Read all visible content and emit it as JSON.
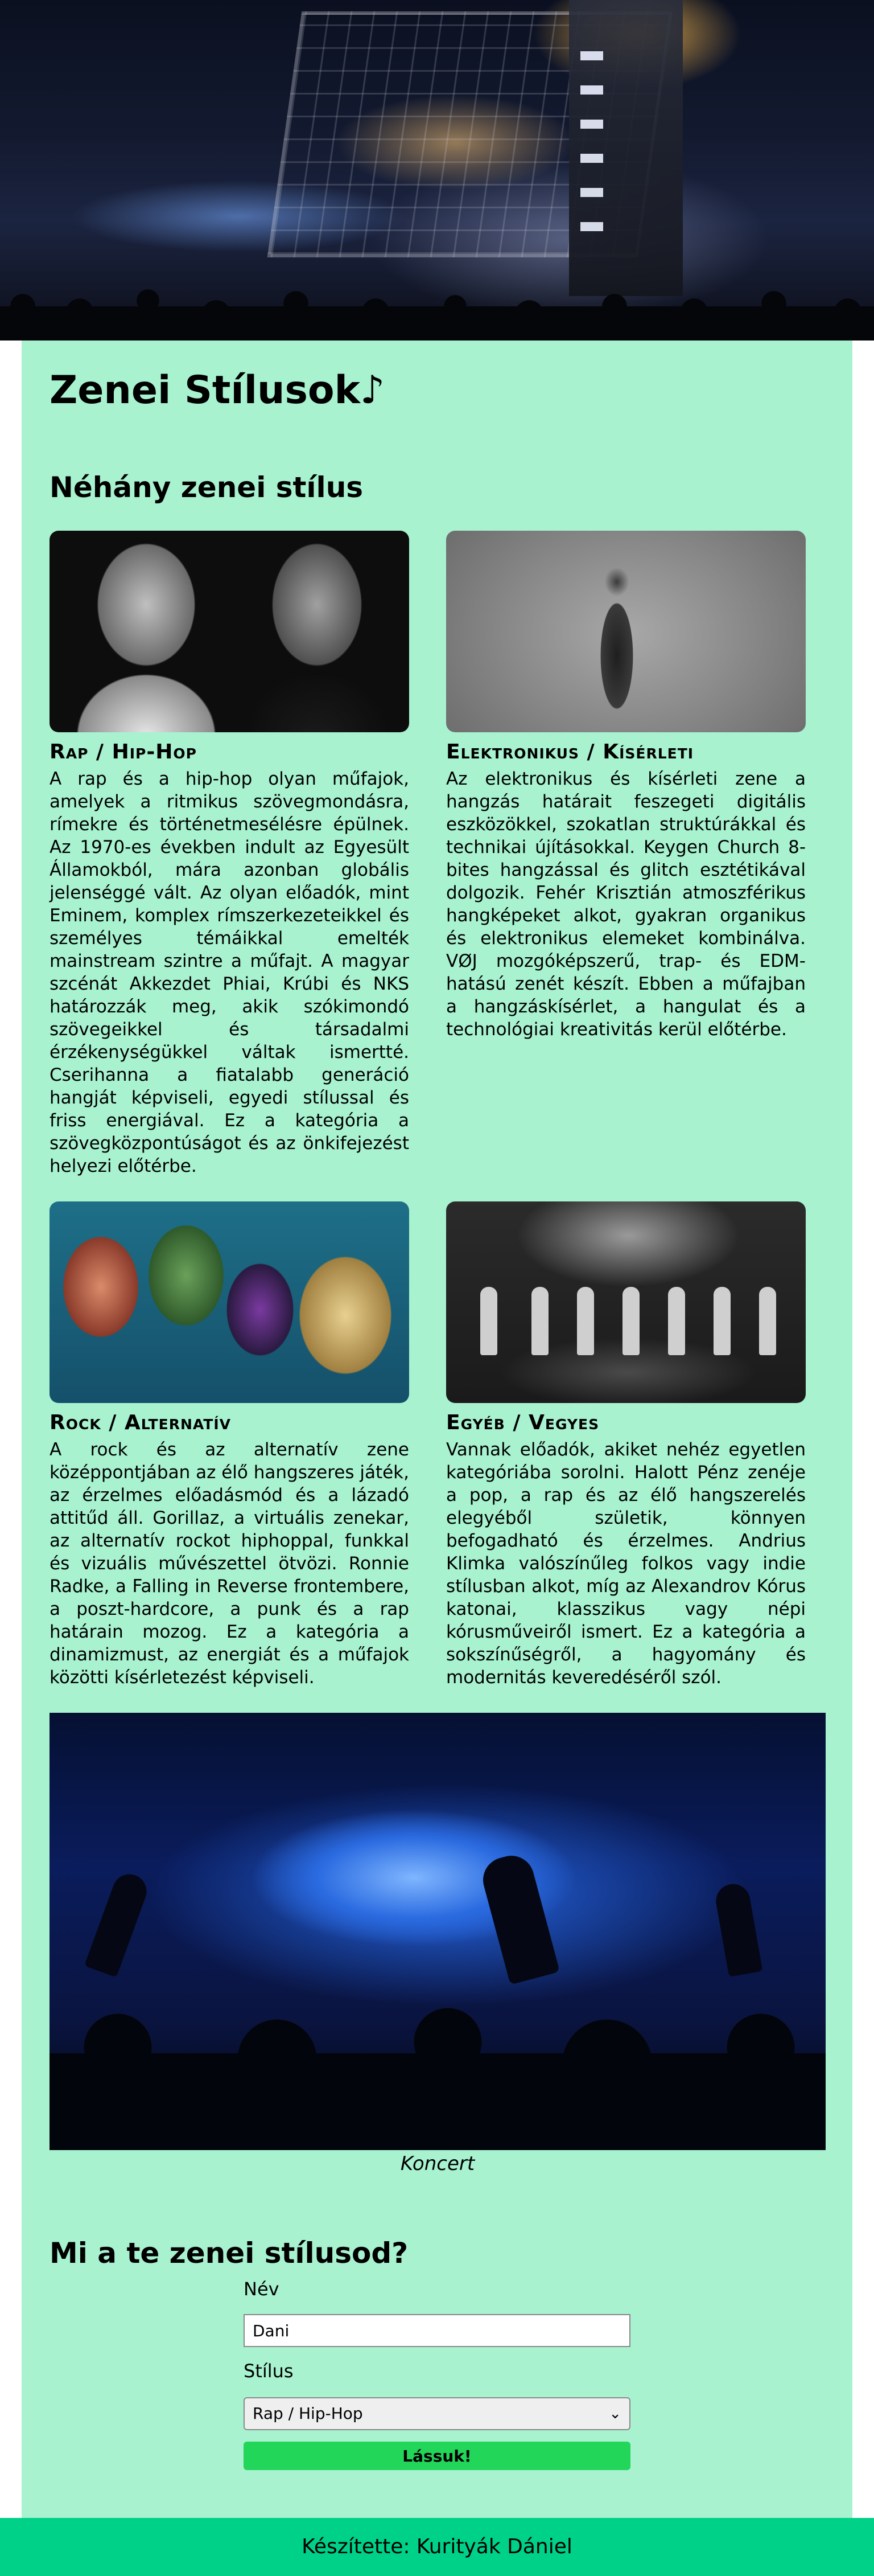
{
  "header": {
    "title": "Zenei Stílusok",
    "title_note": "♪"
  },
  "styles_section": {
    "title": "Néhány zenei stílus",
    "cards": [
      {
        "title": "Rap / Hip-Hop",
        "text": "A rap és a hip-hop olyan műfajok, amelyek a ritmikus szövegmondásra, rímekre és történetmesélésre épülnek. Az 1970-es években indult az Egyesült Államokból, mára azonban globális jelenséggé vált. Az olyan előadók, mint Eminem, komplex rímszerkezeteikkel és személyes témáikkal emelték mainstream szintre a műfajt. A magyar szcénát Akkezdet Phiai, Krúbi és NKS határozzák meg, akik szókimondó szövegeikkel és társadalmi érzékenységükkel váltak ismertté. Cserihanna a fiatalabb generáció hangját képviseli, egyedi stílussal és friss energiával. Ez a kategória a szövegközpontúságot és az önkifejezést helyezi előtérbe."
      },
      {
        "title": "Elektronikus / Kísérleti",
        "text": "Az elektronikus és kísérleti zene a hangzás határait feszegeti digitális eszközökkel, szokatlan struktúrákkal és technikai újításokkal. Keygen Church 8-bites hangzással és glitch esztétikával dolgozik. Fehér Krisztián atmoszférikus hangképeket alkot, gyakran organikus és elektronikus elemeket kombinálva. VØJ mozgóképszerű, trap- és EDM-hatású zenét készít. Ebben a műfajban a hangzáskísérlet, a hangulat és a technológiai kreativitás kerül előtérbe."
      },
      {
        "title": "Rock / Alternatív",
        "text": "A rock és az alternatív zene középpontjában az élő hangszeres játék, az érzelmes előadásmód és a lázadó attitűd áll. Gorillaz, a virtuális zenekar, az alternatív rockot hiphoppal, funkkal és vizuális művészettel ötvözi. Ronnie Radke, a Falling in Reverse frontembere, a poszt-hardcore, a punk és a rap határain mozog. Ez a kategória a dinamizmust, az energiát és a műfajok közötti kísérletezést képviseli."
      },
      {
        "title": "Egyéb / Vegyes",
        "text": "Vannak előadók, akiket nehéz egyetlen kategóriába sorolni. Halott Pénz zenéje a pop, a rap és az élő hangszerelés elegyéből születik, könnyen befogadható és érzelmes. Andrius Klimka valószínűleg folkos vagy indie stílusban alkot, míg az Alexandrov Kórus katonai, klasszikus vagy népi kórusműveiről ismert. Ez a kategória a sokszínűségről, a hagyomány és modernitás keveredéséről szól."
      }
    ]
  },
  "concert": {
    "caption": "Koncert"
  },
  "form": {
    "title": "Mi a te zenei stílusod?",
    "name_label": "Név",
    "name_value": "Dani",
    "style_label": "Stílus",
    "style_selected": "Rap / Hip-Hop",
    "submit_label": "Lássuk!"
  },
  "footer": {
    "text": "Készítette: Kurityák Dániel"
  },
  "colors": {
    "main_bg": "#a8f2d0",
    "footer_bg": "#00d189",
    "button_bg": "#22d65a"
  }
}
